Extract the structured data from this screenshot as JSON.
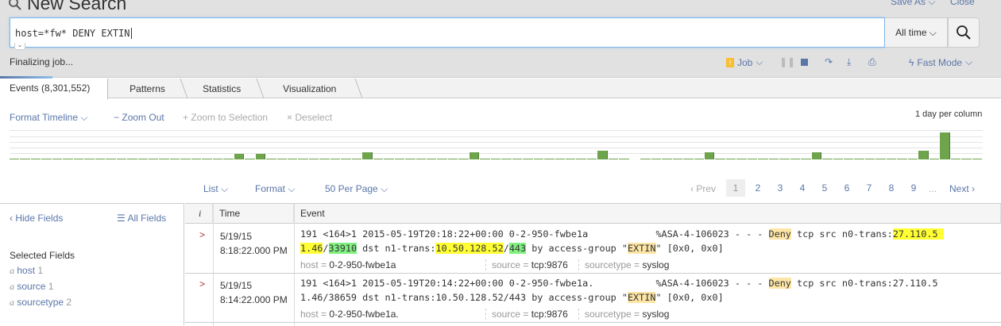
{
  "header": {
    "title": "New Search",
    "save_as": "Save As",
    "close": "Close",
    "query": "host=*fw* DENY EXTIN",
    "time_range": "All time",
    "status": "Finalizing job...",
    "job": "Job",
    "mode": "Fast Mode"
  },
  "tabs": [
    {
      "label": "Events (8,301,552)"
    },
    {
      "label": "Patterns"
    },
    {
      "label": "Statistics"
    },
    {
      "label": "Visualization"
    }
  ],
  "timeline_controls": {
    "format": "Format Timeline",
    "zoom_out": "Zoom Out",
    "zoom_sel": "Zoom to Selection",
    "deselect": "Deselect",
    "scale": "1 day per column"
  },
  "chart_data": {
    "type": "bar",
    "bar_color": "#6ea44c",
    "values": [
      1,
      1,
      1,
      1,
      1,
      1,
      1,
      1,
      1,
      1,
      1,
      1,
      1,
      1,
      1,
      1,
      1,
      1,
      1,
      1,
      1,
      6,
      1,
      6,
      1,
      1,
      1,
      1,
      1,
      1,
      1,
      1,
      1,
      8,
      1,
      1,
      1,
      1,
      1,
      1,
      1,
      1,
      1,
      8,
      1,
      1,
      1,
      1,
      1,
      1,
      1,
      1,
      1,
      1,
      1,
      9,
      1,
      1,
      0,
      1,
      1,
      1,
      1,
      1,
      1,
      8,
      1,
      1,
      1,
      1,
      1,
      1,
      1,
      1,
      1,
      8,
      1,
      1,
      1,
      1,
      1,
      1,
      1,
      1,
      1,
      9,
      1,
      29,
      1,
      1,
      1
    ]
  },
  "results_controls": {
    "list": "List",
    "format": "Format",
    "per_page": "50 Per Page",
    "prev": "Prev",
    "next": "Next",
    "pages": [
      "1",
      "2",
      "3",
      "4",
      "5",
      "6",
      "7",
      "8",
      "9"
    ],
    "ellipsis": "...",
    "current_page": "1"
  },
  "sidebar": {
    "hide": "Hide Fields",
    "all": "All Fields",
    "selected_title": "Selected Fields",
    "fields": [
      {
        "type": "a",
        "name": "host",
        "count": "1"
      },
      {
        "type": "a",
        "name": "source",
        "count": "1"
      },
      {
        "type": "a",
        "name": "sourcetype",
        "count": "2"
      }
    ]
  },
  "table": {
    "headers": {
      "i": "i",
      "time": "Time",
      "event": "Event"
    },
    "rows": [
      {
        "date": "5/19/15",
        "time": "8:18:22.000 PM",
        "line1": [
          {
            "t": "191 <164>1 2015-05-19T20:18:22+00:00 0-2-950-fwbe1a            %ASA-4-106023 - - - "
          },
          {
            "t": "Deny",
            "hl": "tan"
          },
          {
            "t": " tcp src n0-trans:"
          },
          {
            "t": "27.110.5 ",
            "hl": "yellow"
          }
        ],
        "line2": [
          {
            "t": "1.46",
            "hl": "yellow"
          },
          {
            "t": "/"
          },
          {
            "t": "33910",
            "hl": "green"
          },
          {
            "t": " dst n1-trans:"
          },
          {
            "t": "10.50.128.52",
            "hl": "yellow"
          },
          {
            "t": "/"
          },
          {
            "t": "443",
            "hl": "green"
          },
          {
            "t": " by access-group \""
          },
          {
            "t": "EXTIN",
            "hl": "tan"
          },
          {
            "t": "\" [0x0, 0x0]"
          }
        ],
        "host": "0-2-950-fwbe1a",
        "source": "tcp:9876",
        "sourcetype": "syslog"
      },
      {
        "date": "5/19/15",
        "time": "8:14:22.000 PM",
        "line1": [
          {
            "t": "191 <164>1 2015-05-19T20:14:22+00:00 0-2-950-fwbe1a.           %ASA-4-106023 - - - "
          },
          {
            "t": "Deny",
            "hl": "tan"
          },
          {
            "t": " tcp src n0-trans:27.110.5"
          }
        ],
        "line2": [
          {
            "t": "1.46/38659 dst n1-trans:10.50.128.52/443 by access-group \""
          },
          {
            "t": "EXTIN",
            "hl": "tan"
          },
          {
            "t": "\" [0x0, 0x0]"
          }
        ],
        "host": "0-2-950-fwbe1a.",
        "source": "tcp:9876",
        "sourcetype": "syslog"
      }
    ],
    "field_labels": {
      "host": "host",
      "source": "source",
      "sourcetype": "sourcetype"
    }
  }
}
